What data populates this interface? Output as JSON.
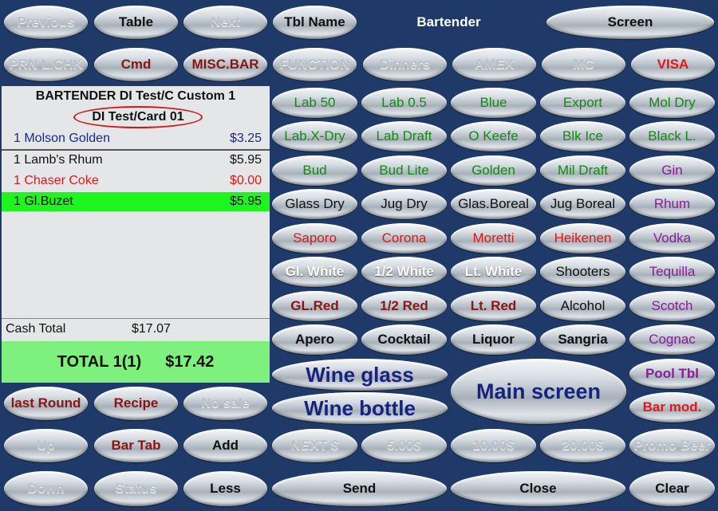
{
  "top_row": {
    "previous": "Previous",
    "table": "Table",
    "next": "Next",
    "tbl_name": "Tbl Name",
    "bartender": "Bartender",
    "screen": "Screen"
  },
  "second_row": {
    "prn": "PRN L.CHK",
    "cmd": "Cmd",
    "misc_bar": "MISC.BAR",
    "function": "FUNCTION",
    "dinners": "Dinners",
    "amex": "AMEX",
    "mc": "MC",
    "visa": "VISA"
  },
  "ticket": {
    "title": "BARTENDER DI Test/C Custom  1",
    "card": "DI Test/Card 01",
    "items": [
      {
        "qty_name": "1 Molson Golden",
        "price": "$3.25"
      },
      {
        "qty_name": "1 Lamb's Rhum",
        "price": "$5.95"
      },
      {
        "qty_name": "1 Chaser Coke",
        "price": "$0.00"
      },
      {
        "qty_name": "1 Gl.Buzet",
        "price": "$5.95"
      }
    ],
    "cash_total_label": "Cash Total",
    "cash_total_value": "$17.07",
    "total_label": "TOTAL  1(1)",
    "total_value": "$17.42"
  },
  "grid": [
    [
      "Lab 50",
      "Lab 0.5",
      "Blue",
      "Export",
      "Mol Dry"
    ],
    [
      "Lab.X-Dry",
      "Lab Draft",
      "O Keefe",
      "Blk Ice",
      "Black L."
    ],
    [
      "Bud",
      "Bud Lite",
      "Golden",
      "Mil Draft",
      "Gin"
    ],
    [
      "Glass Dry",
      "Jug Dry",
      "Glas.Boreal",
      "Jug Boreal",
      "Rhum"
    ],
    [
      "Saporo",
      "Corona",
      "Moretti",
      "Heikenen",
      "Vodka"
    ],
    [
      "Gl. White",
      "1/2  White",
      "Lt. White",
      "Shooters",
      "Tequilla"
    ],
    [
      "GL.Red",
      "1/2 Red",
      "Lt. Red",
      "Alcohol",
      "Scotch"
    ],
    [
      "Apero",
      "Cocktail",
      "Liquor",
      "Sangria",
      "Cognac"
    ]
  ],
  "big": {
    "wine_glass": "Wine glass",
    "wine_bottle": "Wine bottle",
    "main_screen": "Main screen",
    "pool_tbl": "Pool Tbl",
    "bar_mod": "Bar mod."
  },
  "bottom": {
    "last_round": "last Round",
    "recipe": "Recipe",
    "no_sale": "No sale",
    "up": "Up",
    "bar_tab": "Bar Tab",
    "add": "Add",
    "next_dollar": "NEXT $",
    "five": "5.00$",
    "ten": "10.00$",
    "twenty": "20.00$",
    "promo": "Promo Beer",
    "down": "Down",
    "status": "Status",
    "less": "Less",
    "send": "Send",
    "close": "Close",
    "clear": "Clear"
  }
}
